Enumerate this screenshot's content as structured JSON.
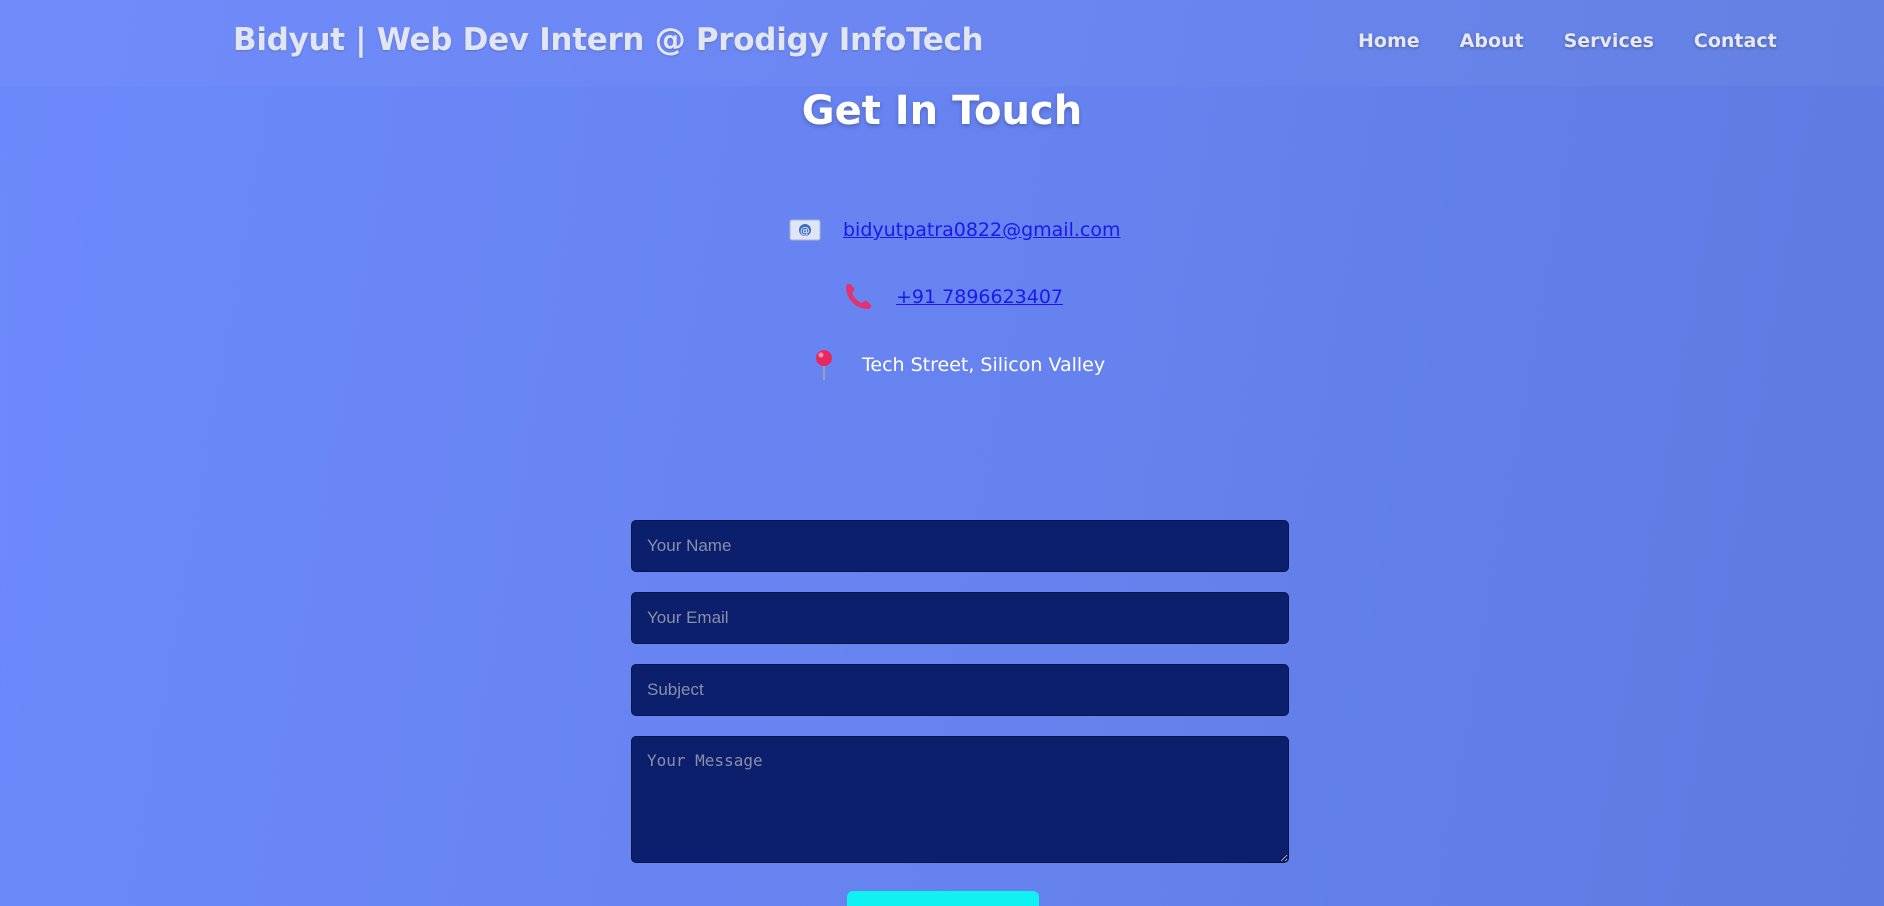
{
  "header": {
    "brand": "Bidyut | Web Dev Intern @ Prodigy InfoTech",
    "nav": {
      "home": "Home",
      "about": "About",
      "services": "Services",
      "contact": "Contact"
    }
  },
  "contact_section": {
    "title": "Get In Touch",
    "email": {
      "icon": "email-icon",
      "text": "bidyutpatra0822@gmail.com"
    },
    "phone": {
      "icon": "phone-icon",
      "text": "+91 7896623407"
    },
    "address": {
      "icon": "location-pin-icon",
      "text": "Tech Street, Silicon Valley"
    }
  },
  "form": {
    "name_placeholder": "Your Name",
    "email_placeholder": "Your Email",
    "subject_placeholder": "Subject",
    "message_placeholder": "Your Message",
    "send_label": ""
  },
  "colors": {
    "background": "#6783f0",
    "field_background": "#0c1f6d",
    "link": "#1a1ae6",
    "button": "#10f2f2"
  }
}
